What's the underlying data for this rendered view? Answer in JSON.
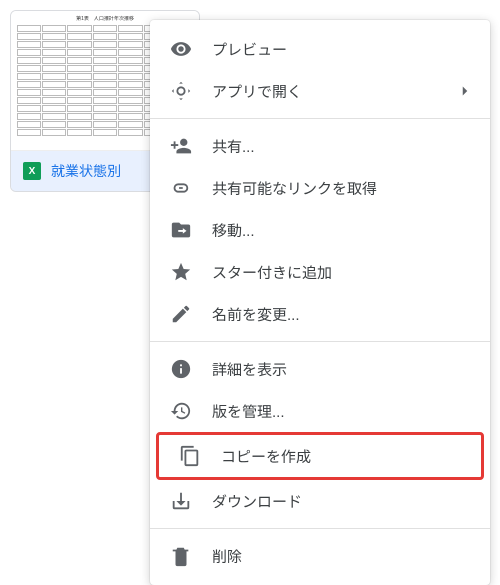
{
  "file": {
    "icon_letter": "X",
    "name": "就業状態別"
  },
  "menu": {
    "preview": "プレビュー",
    "open_with": "アプリで開く",
    "share": "共有...",
    "get_link": "共有可能なリンクを取得",
    "move": "移動...",
    "star": "スター付きに追加",
    "rename": "名前を変更...",
    "details": "詳細を表示",
    "versions": "版を管理...",
    "make_copy": "コピーを作成",
    "download": "ダウンロード",
    "delete": "削除"
  }
}
